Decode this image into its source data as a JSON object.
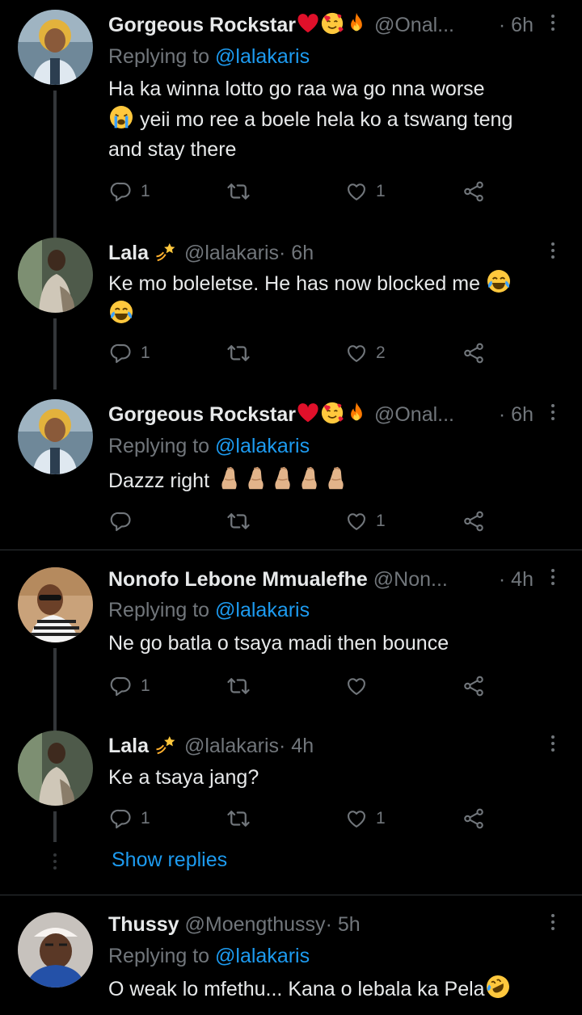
{
  "reply_prefix": "Replying to",
  "tweets": [
    {
      "name": "Gorgeous Rockstar",
      "handle": "@Onal...",
      "time": "· 6h",
      "reply_to": "@lalakaris",
      "text_lines": [
        "Ha ka winna lotto go raa wa go nna worse",
        "yeii mo ree a boele hela ko a tswang teng",
        "and stay there"
      ],
      "replies": "1",
      "retweets": "",
      "likes": "1"
    },
    {
      "name": "Lala",
      "handle": "@lalakaris",
      "time": "· 6h",
      "text_lines": [
        "Ke mo boleletse. He has now blocked me"
      ],
      "replies": "1",
      "retweets": "",
      "likes": "2"
    },
    {
      "name": "Gorgeous Rockstar",
      "handle": "@Onal...",
      "time": "· 6h",
      "reply_to": "@lalakaris",
      "text_lines": [
        "Dazzz right"
      ],
      "replies": "",
      "retweets": "",
      "likes": "1"
    },
    {
      "name": "Nonofo Lebone Mmualefhe",
      "handle": "@Non...",
      "time": "· 4h",
      "reply_to": "@lalakaris",
      "text_lines": [
        "Ne go batla o tsaya madi then bounce"
      ],
      "replies": "1",
      "retweets": "",
      "likes": ""
    },
    {
      "name": "Lala",
      "handle": "@lalakaris",
      "time": "· 4h",
      "text_lines": [
        "Ke a tsaya jang?"
      ],
      "replies": "1",
      "retweets": "",
      "likes": "1"
    },
    {
      "name": "Thussy",
      "handle": "@Moengthussy",
      "time": "· 5h",
      "reply_to": "@lalakaris",
      "text_lines": [
        "O weak lo mfethu... Kana o lebala ka Pela"
      ],
      "replies": "",
      "retweets": "",
      "likes": ""
    }
  ],
  "show_replies": "Show replies",
  "colors": {
    "background": "#000000",
    "text": "#e7e9ea",
    "muted": "#71767b",
    "link": "#1d9bf0",
    "heart": "#f91880"
  },
  "icons": [
    "reply-icon",
    "retweet-icon",
    "like-icon",
    "share-icon",
    "more-icon",
    "heart-emoji",
    "smiling-hearts-emoji",
    "fire-emoji",
    "crying-emoji",
    "tears-of-joy-emoji",
    "dizzy-emoji",
    "pinched-fingers-emoji",
    "rofl-emoji"
  ]
}
